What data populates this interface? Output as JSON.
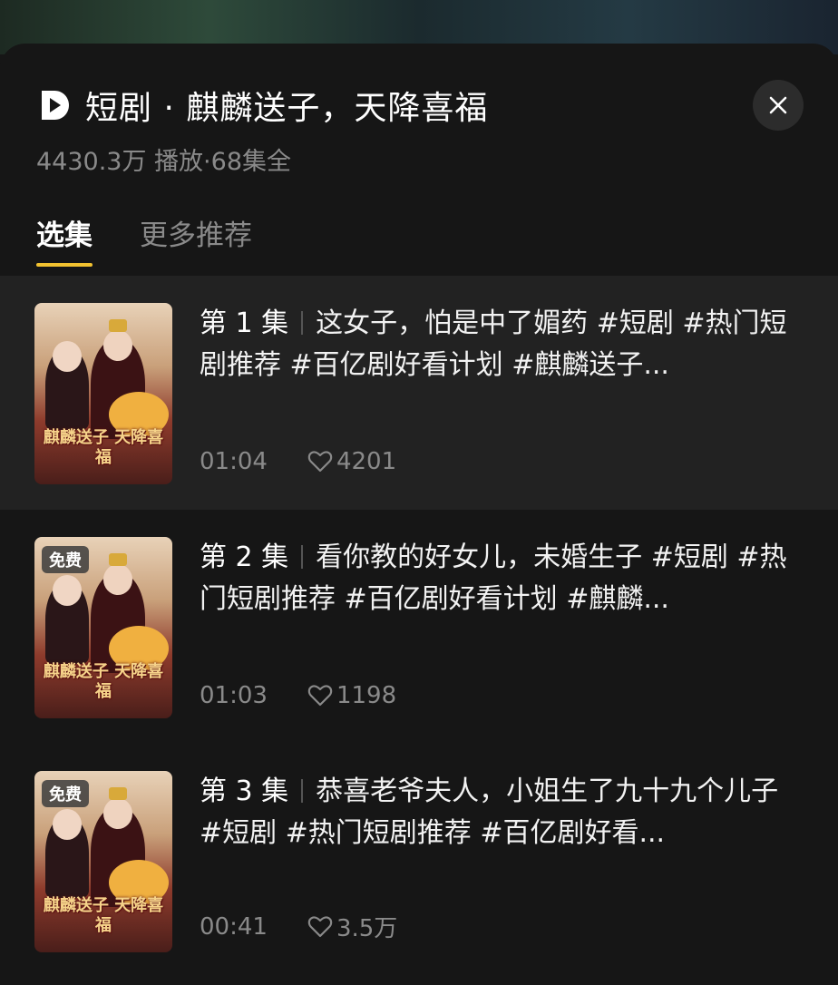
{
  "header": {
    "title": "短剧 · 麒麟送子，天降喜福",
    "subtitle": "4430.3万 播放·68集全",
    "logo_icon": "play-logo-icon",
    "close_icon": "close-icon"
  },
  "tabs": [
    {
      "label": "选集",
      "active": true
    },
    {
      "label": "更多推荐",
      "active": false
    }
  ],
  "thumbnail_caption": "麒麟送子 天降喜福",
  "episodes": [
    {
      "number": "第 1 集",
      "description": "这女子，怕是中了媚药 #短剧 #热门短剧推荐 #百亿剧好看计划 #麒麟送子...",
      "duration": "01:04",
      "likes": "4201",
      "badge": "",
      "current": true
    },
    {
      "number": "第 2 集",
      "description": "看你教的好女儿，未婚生子 #短剧 #热门短剧推荐 #百亿剧好看计划 #麒麟...",
      "duration": "01:03",
      "likes": "1198",
      "badge": "免费",
      "current": false
    },
    {
      "number": "第 3 集",
      "description": "恭喜老爷夫人，小姐生了九十九个儿子 #短剧 #热门短剧推荐 #百亿剧好看...",
      "duration": "00:41",
      "likes": "3.5万",
      "badge": "免费",
      "current": false
    }
  ],
  "colors": {
    "accent": "#f2c230",
    "background": "#161616",
    "current_row": "#222222",
    "muted_text": "#8a8a8a"
  }
}
